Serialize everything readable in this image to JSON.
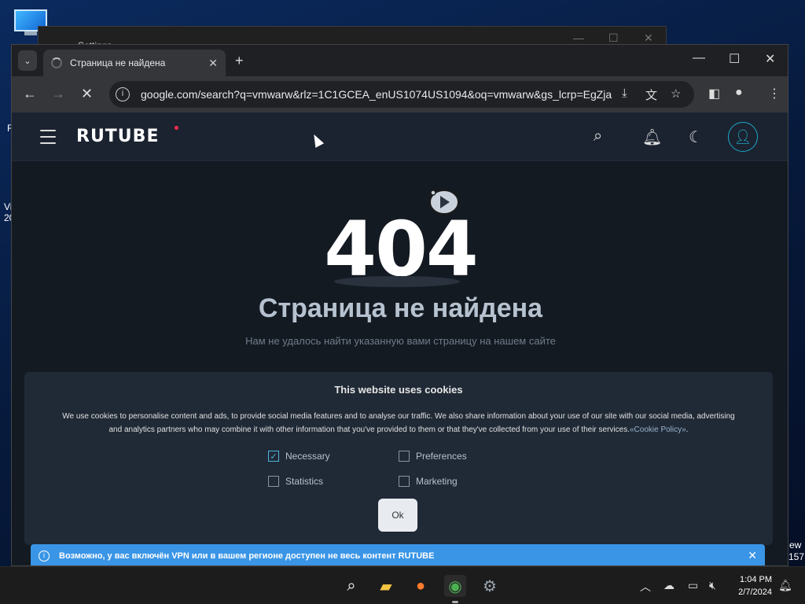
{
  "desktop": {
    "left_texts": [
      "R",
      "Vi",
      "20"
    ],
    "right_texts": [
      "ew",
      "157"
    ]
  },
  "settings_window": {
    "title": "Settings"
  },
  "browser": {
    "tab_title": "Страница не найдена",
    "address": "google.com/search?q=vmwarw&rlz=1C1GCEA_enUS1074US1094&oq=vmwarw&gs_lcrp=EgZja..."
  },
  "site": {
    "logo": "RUTUBE",
    "error_code": "404",
    "error_title": "Страница не найдена",
    "error_subtitle": "Нам не удалось найти указанную вами страницу на нашем сайте"
  },
  "cookie": {
    "title": "This website uses cookies",
    "text": "We use cookies to personalise content and ads, to provide social media features and to analyse our traffic. We also share information about your use of our site with our social media, advertising and analytics partners who may combine it with other information that you've provided to them or that they've collected from your use of their services.",
    "policy_link": "«Cookie Policy»",
    "options": {
      "necessary": "Necessary",
      "preferences": "Preferences",
      "statistics": "Statistics",
      "marketing": "Marketing"
    },
    "ok": "Ok"
  },
  "vpn_notice": "Возможно, у вас включён VPN или в вашем регионе доступен не весь контент RUTUBE",
  "taskbar": {
    "time": "1:04 PM",
    "date": "2/7/2024"
  }
}
